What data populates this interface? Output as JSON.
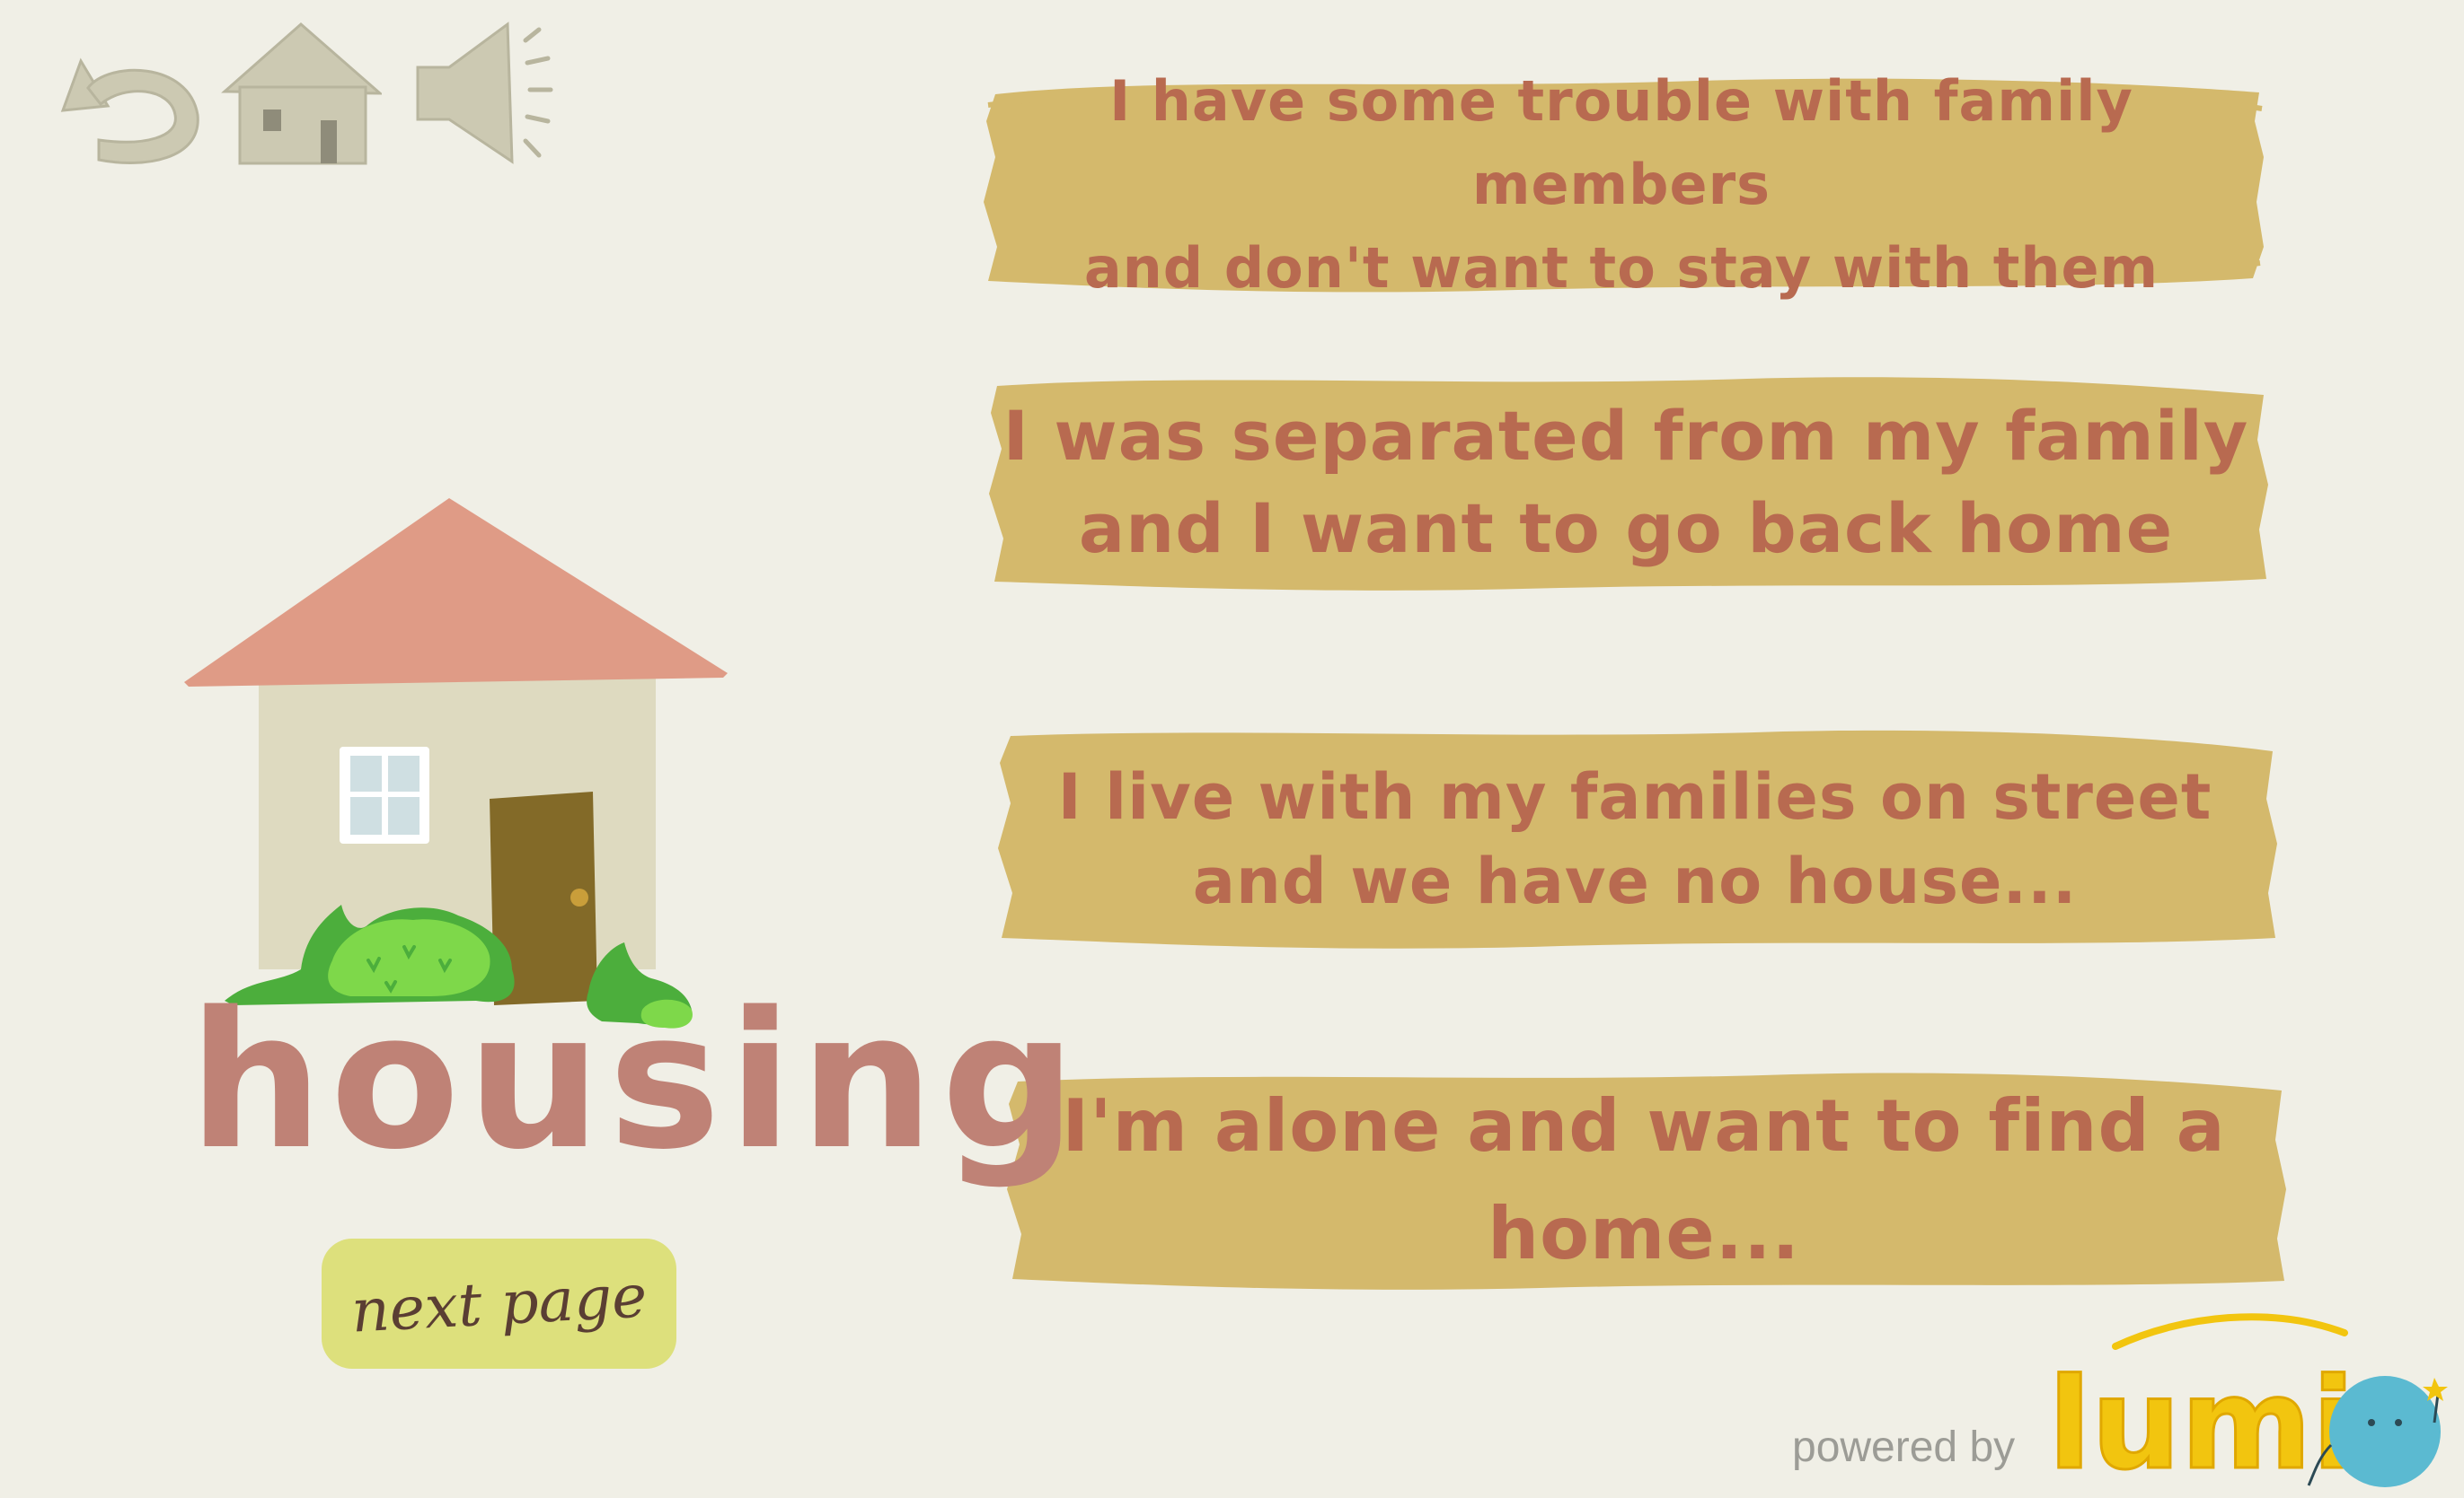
{
  "toolbar": {
    "back_icon": "undo-arrow-icon",
    "home_icon": "house-icon",
    "sound_icon": "speaker-icon"
  },
  "options": [
    {
      "label": "I have some trouble with family members\nand don't want to stay with them"
    },
    {
      "label": "I was separated from my family\nand I want to go back home"
    },
    {
      "label": "I live with my families on street\nand we have no house..."
    },
    {
      "label": "I'm alone and want to find a home..."
    }
  ],
  "category": {
    "title": "housing",
    "illustration": "house-with-bushes-illustration"
  },
  "next_button": {
    "label": "next page"
  },
  "footer": {
    "powered_by": "powered by",
    "brand": "lumi"
  },
  "colors": {
    "background": "#f0efe6",
    "option_fill": "#d4b96c",
    "option_text": "#b86a50",
    "title": "#bf8276",
    "next_button": "#dde07c",
    "icon": "#ccc9b2",
    "brand_yellow": "#f2c50f",
    "brand_blue": "#5bbad1"
  }
}
